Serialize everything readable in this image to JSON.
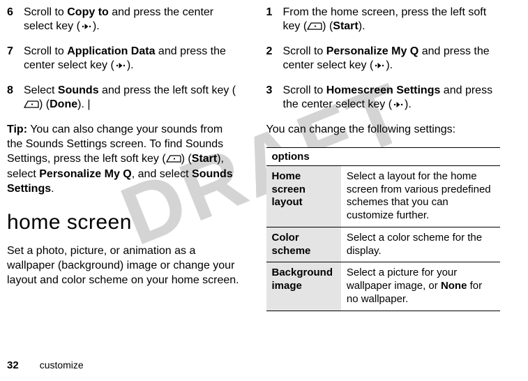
{
  "watermark": "DRAFT",
  "left": {
    "steps": [
      {
        "n": "6",
        "pre": "Scroll to ",
        "b1": "Copy to",
        "mid": " and press the center select key (",
        "iconA": "center",
        "post": ")."
      },
      {
        "n": "7",
        "pre": "Scroll to ",
        "b1": "Application Data",
        "mid": " and press the center select key (",
        "iconA": "center",
        "post": ")."
      },
      {
        "n": "8",
        "pre": "Select ",
        "b1": "Sounds",
        "mid": " and press the left soft key (",
        "iconA": "leftsoft",
        "mid2": ") (",
        "b2": "Done",
        "post": "). |"
      }
    ],
    "tip_label": "Tip:",
    "tip_1": " You can also change your sounds from the Sounds Settings screen. To find Sounds Settings, press the left soft key (",
    "tip_icon": "leftsoft",
    "tip_2": ") (",
    "tip_b1": "Start",
    "tip_3": "), select ",
    "tip_b2": "Personalize My Q",
    "tip_4": ", and select ",
    "tip_b3": "Sounds Settings",
    "tip_5": ".",
    "heading": "home screen",
    "para": "Set a photo, picture, or animation as a wallpaper (background) image or change your layout and color scheme on your home screen."
  },
  "right": {
    "steps": [
      {
        "n": "1",
        "pre": "From the home screen, press the left soft key (",
        "iconA": "leftsoft",
        "mid2": ") (",
        "b2": "Start",
        "post": ")."
      },
      {
        "n": "2",
        "pre": "Scroll to ",
        "b1": "Personalize My Q",
        "mid": " and press the center select key (",
        "iconA": "center",
        "post": ")."
      },
      {
        "n": "3",
        "pre": "Scroll to ",
        "b1": "Homescreen Settings",
        "mid": " and press the center select key (",
        "iconA": "center",
        "post": ")."
      }
    ],
    "intro": "You can change the following settings:",
    "table_header": "options",
    "rows": [
      {
        "k": "Home screen layout",
        "v": "Select a layout for the home screen from various predefined schemes that you can customize further."
      },
      {
        "k": "Color scheme",
        "v": "Select a color scheme for the display."
      },
      {
        "k": "Background image",
        "v_pre": "Select a picture for your wallpaper image, or ",
        "v_b": "None",
        "v_post": " for no wallpaper."
      }
    ]
  },
  "footer": {
    "page": "32",
    "section": "customize"
  }
}
